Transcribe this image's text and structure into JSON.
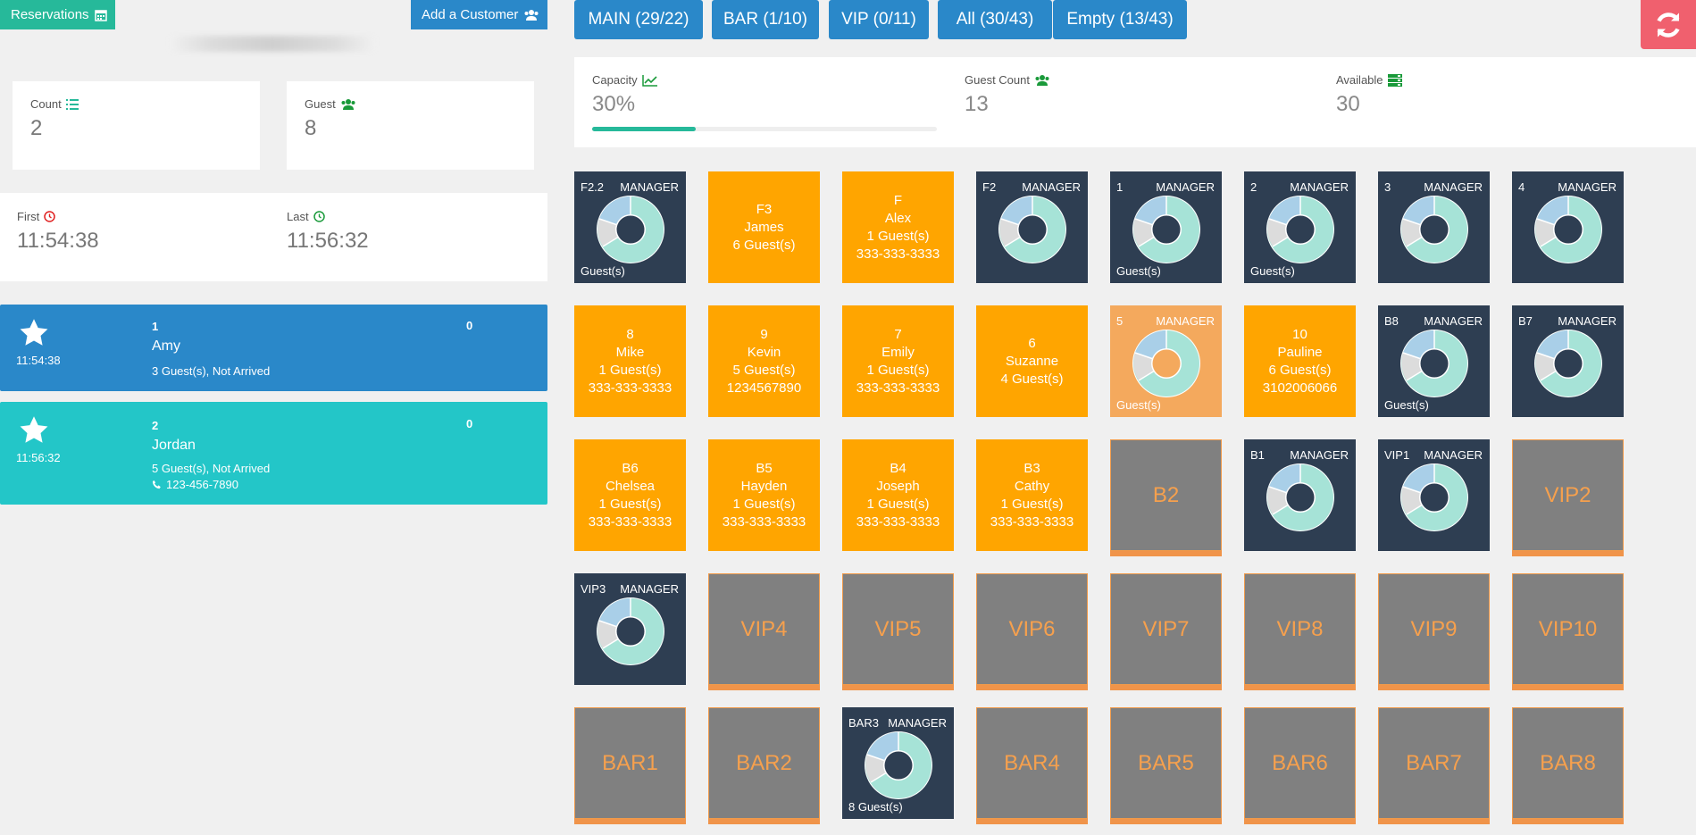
{
  "left": {
    "reservations_button": "Reservations",
    "add_customer_button": "Add a Customer",
    "count": {
      "label": "Count",
      "value": "2"
    },
    "guest": {
      "label": "Guest",
      "value": "8"
    },
    "first": {
      "label": "First",
      "value": "11:54:38"
    },
    "last": {
      "label": "Last",
      "value": "11:56:32"
    },
    "reservations": [
      {
        "time": "11:54:38",
        "number": "1",
        "name": "Amy",
        "status": "3 Guest(s), Not Arrived",
        "count": "0",
        "phone": ""
      },
      {
        "time": "11:56:32",
        "number": "2",
        "name": "Jordan",
        "status": "5 Guest(s), Not Arrived",
        "count": "0",
        "phone": "123-456-7890"
      }
    ]
  },
  "nav": {
    "tabs": [
      "MAIN (29/22)",
      "BAR (1/10)",
      "VIP (0/11)",
      "All (30/43)",
      "Empty (13/43)"
    ]
  },
  "stats": {
    "capacity": {
      "label": "Capacity",
      "value": "30%",
      "progress_fraction": 0.3
    },
    "guest_count": {
      "label": "Guest Count",
      "value": "13"
    },
    "available": {
      "label": "Available",
      "value": "30"
    }
  },
  "tables": {
    "manager_label": "MANAGER",
    "guests_label": "Guest(s)",
    "row1": [
      {
        "kind": "dark",
        "name": "F2.2",
        "footer": "Guest(s)"
      },
      {
        "kind": "orange",
        "lines": [
          "F3",
          "James",
          "6 Guest(s)"
        ]
      },
      {
        "kind": "orange",
        "lines": [
          "F",
          "Alex",
          "1 Guest(s)",
          "333-333-3333"
        ]
      },
      {
        "kind": "dark",
        "name": "F2",
        "footer": ""
      },
      {
        "kind": "dark",
        "name": "1",
        "footer": "Guest(s)"
      },
      {
        "kind": "dark",
        "name": "2",
        "footer": "Guest(s)"
      },
      {
        "kind": "dark",
        "name": "3",
        "footer": ""
      },
      {
        "kind": "dark",
        "name": "4",
        "footer": ""
      }
    ],
    "row2": [
      {
        "kind": "orange",
        "lines": [
          "8",
          "Mike",
          "1 Guest(s)",
          "333-333-3333"
        ]
      },
      {
        "kind": "orange",
        "lines": [
          "9",
          "Kevin",
          "5 Guest(s)",
          "1234567890"
        ]
      },
      {
        "kind": "orange",
        "lines": [
          "7",
          "Emily",
          "1 Guest(s)",
          "333-333-3333"
        ]
      },
      {
        "kind": "orange",
        "lines": [
          "6",
          "Suzanne",
          "4 Guest(s)"
        ]
      },
      {
        "kind": "peach",
        "name": "5",
        "footer": "Guest(s)"
      },
      {
        "kind": "orange",
        "lines": [
          "10",
          "Pauline",
          "6 Guest(s)",
          "3102006066"
        ]
      },
      {
        "kind": "dark",
        "name": "B8",
        "footer": "Guest(s)"
      },
      {
        "kind": "dark",
        "name": "B7",
        "footer": ""
      }
    ],
    "row3": [
      {
        "kind": "orange",
        "lines": [
          "B6",
          "Chelsea",
          "1 Guest(s)",
          "333-333-3333"
        ]
      },
      {
        "kind": "orange",
        "lines": [
          "B5",
          "Hayden",
          "1 Guest(s)",
          "333-333-3333"
        ]
      },
      {
        "kind": "orange",
        "lines": [
          "B4",
          "Joseph",
          "1 Guest(s)",
          "333-333-3333"
        ]
      },
      {
        "kind": "orange",
        "lines": [
          "B3",
          "Cathy",
          "1 Guest(s)",
          "333-333-3333"
        ]
      },
      {
        "kind": "gray",
        "name": "B2"
      },
      {
        "kind": "dark",
        "name": "B1",
        "footer": ""
      },
      {
        "kind": "dark",
        "name": "VIP1",
        "footer": ""
      },
      {
        "kind": "gray",
        "name": "VIP2"
      }
    ],
    "row4": [
      {
        "kind": "dark",
        "name": "VIP3",
        "footer": ""
      },
      {
        "kind": "gray",
        "name": "VIP4"
      },
      {
        "kind": "gray",
        "name": "VIP5"
      },
      {
        "kind": "gray",
        "name": "VIP6"
      },
      {
        "kind": "gray",
        "name": "VIP7"
      },
      {
        "kind": "gray",
        "name": "VIP8"
      },
      {
        "kind": "gray",
        "name": "VIP9"
      },
      {
        "kind": "gray",
        "name": "VIP10"
      }
    ],
    "row5": [
      {
        "kind": "gray",
        "name": "BAR1"
      },
      {
        "kind": "gray",
        "name": "BAR2"
      },
      {
        "kind": "dark",
        "name": "BAR3",
        "footer": "8 Guest(s)"
      },
      {
        "kind": "gray",
        "name": "BAR4"
      },
      {
        "kind": "gray",
        "name": "BAR5"
      },
      {
        "kind": "gray",
        "name": "BAR6"
      },
      {
        "kind": "gray",
        "name": "BAR7"
      },
      {
        "kind": "gray",
        "name": "BAR8"
      }
    ]
  },
  "colors": {
    "green": "#26b99a",
    "blue": "#2a88c9",
    "teal": "#23c6c8",
    "orange": "#ffa500",
    "dark": "#2e3e52",
    "refresh": "#f0606e"
  }
}
